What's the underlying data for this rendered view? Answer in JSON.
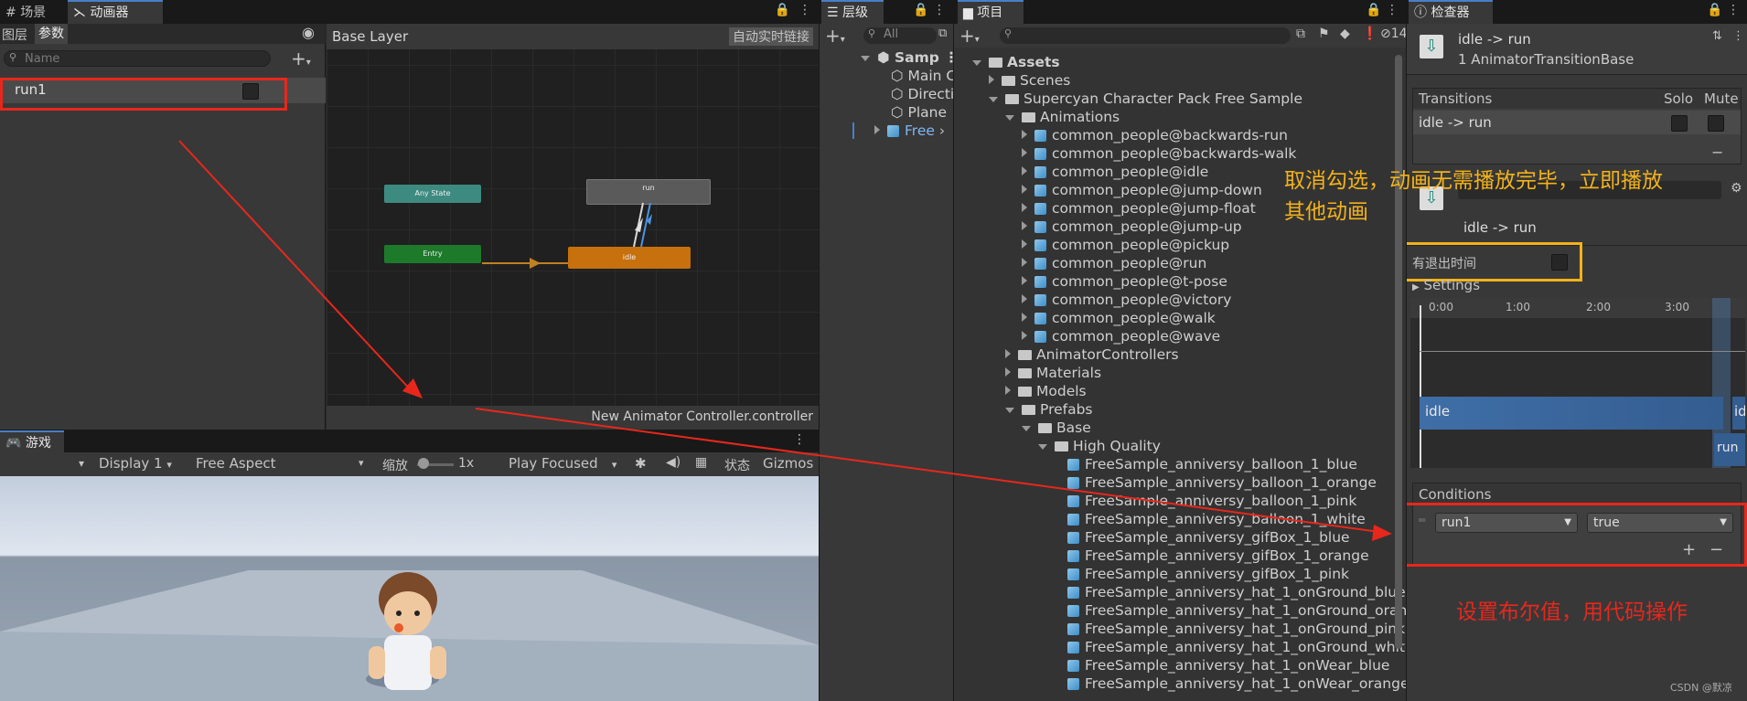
{
  "animator": {
    "tab_scene": "场景",
    "tab_animator": "动画器",
    "subtab_layers": "图层",
    "subtab_params": "参数",
    "search_placeholder": "Name",
    "param_name": "run1",
    "layer_name": "Base Layer",
    "auto_live_link": "自动实时链接",
    "nodes": {
      "any_state": "Any State",
      "entry": "Entry",
      "run": "run",
      "idle": "idle"
    },
    "controller_file": "New Animator Controller.controller"
  },
  "game": {
    "tab": "游戏",
    "display": "Display 1",
    "aspect": "Free Aspect",
    "scale_label": "缩放",
    "scale_value": "1x",
    "play_mode": "Play Focused",
    "stats": "状态",
    "gizmos": "Gizmos"
  },
  "hierarchy": {
    "tab": "层级",
    "search": "All",
    "items": [
      "Samp",
      "Main C",
      "Directi",
      "Plane",
      "Free"
    ]
  },
  "project": {
    "tab": "项目",
    "count": "14",
    "tree": [
      {
        "label": "Assets",
        "level": 0,
        "kind": "folder",
        "expanded": true
      },
      {
        "label": "Scenes",
        "level": 1,
        "kind": "folder",
        "expanded": false
      },
      {
        "label": "Supercyan Character Pack Free Sample",
        "level": 1,
        "kind": "folder",
        "expanded": true
      },
      {
        "label": "Animations",
        "level": 2,
        "kind": "folder",
        "expanded": true
      },
      {
        "label": "common_people@backwards-run",
        "level": 3,
        "kind": "asset",
        "expanded": false
      },
      {
        "label": "common_people@backwards-walk",
        "level": 3,
        "kind": "asset",
        "expanded": false
      },
      {
        "label": "common_people@idle",
        "level": 3,
        "kind": "asset",
        "expanded": false
      },
      {
        "label": "common_people@jump-down",
        "level": 3,
        "kind": "asset",
        "expanded": false
      },
      {
        "label": "common_people@jump-float",
        "level": 3,
        "kind": "asset",
        "expanded": false
      },
      {
        "label": "common_people@jump-up",
        "level": 3,
        "kind": "asset",
        "expanded": false
      },
      {
        "label": "common_people@pickup",
        "level": 3,
        "kind": "asset",
        "expanded": false
      },
      {
        "label": "common_people@run",
        "level": 3,
        "kind": "asset",
        "expanded": false
      },
      {
        "label": "common_people@t-pose",
        "level": 3,
        "kind": "asset",
        "expanded": false
      },
      {
        "label": "common_people@victory",
        "level": 3,
        "kind": "asset",
        "expanded": false
      },
      {
        "label": "common_people@walk",
        "level": 3,
        "kind": "asset",
        "expanded": false
      },
      {
        "label": "common_people@wave",
        "level": 3,
        "kind": "asset",
        "expanded": false
      },
      {
        "label": "AnimatorControllers",
        "level": 2,
        "kind": "folder",
        "expanded": false
      },
      {
        "label": "Materials",
        "level": 2,
        "kind": "folder",
        "expanded": false
      },
      {
        "label": "Models",
        "level": 2,
        "kind": "folder",
        "expanded": false
      },
      {
        "label": "Prefabs",
        "level": 2,
        "kind": "folder",
        "expanded": true
      },
      {
        "label": "Base",
        "level": 3,
        "kind": "folder",
        "expanded": true
      },
      {
        "label": "High Quality",
        "level": 4,
        "kind": "folder",
        "expanded": true
      },
      {
        "label": "FreeSample_anniversy_balloon_1_blue",
        "level": 5,
        "kind": "prefab"
      },
      {
        "label": "FreeSample_anniversy_balloon_1_orange",
        "level": 5,
        "kind": "prefab"
      },
      {
        "label": "FreeSample_anniversy_balloon_1_pink",
        "level": 5,
        "kind": "prefab"
      },
      {
        "label": "FreeSample_anniversy_balloon_1_white",
        "level": 5,
        "kind": "prefab"
      },
      {
        "label": "FreeSample_anniversy_gifBox_1_blue",
        "level": 5,
        "kind": "prefab"
      },
      {
        "label": "FreeSample_anniversy_gifBox_1_orange",
        "level": 5,
        "kind": "prefab"
      },
      {
        "label": "FreeSample_anniversy_gifBox_1_pink",
        "level": 5,
        "kind": "prefab"
      },
      {
        "label": "FreeSample_anniversy_hat_1_onGround_blue",
        "level": 5,
        "kind": "prefab"
      },
      {
        "label": "FreeSample_anniversy_hat_1_onGround_orange",
        "level": 5,
        "kind": "prefab"
      },
      {
        "label": "FreeSample_anniversy_hat_1_onGround_pink",
        "level": 5,
        "kind": "prefab"
      },
      {
        "label": "FreeSample_anniversy_hat_1_onGround_white",
        "level": 5,
        "kind": "prefab"
      },
      {
        "label": "FreeSample_anniversy_hat_1_onWear_blue",
        "level": 5,
        "kind": "prefab"
      },
      {
        "label": "FreeSample_anniversy_hat_1_onWear_orange",
        "level": 5,
        "kind": "prefab"
      }
    ]
  },
  "inspector": {
    "tab": "检查器",
    "title": "idle -> run",
    "subtitle": "1 AnimatorTransitionBase",
    "transitions_header": "Transitions",
    "solo": "Solo",
    "mute": "Mute",
    "transition_item": "idle -> run",
    "transition_label": "idle -> run",
    "has_exit_time": "有退出时间",
    "settings": "Settings",
    "timeline_ticks": [
      "0:00",
      "1:00",
      "2:00",
      "3:00"
    ],
    "clip_idle": "idle",
    "clip_idle_tail": "id",
    "clip_run": "run",
    "conditions_header": "Conditions",
    "condition_param": "run1",
    "condition_value": "true"
  },
  "annotations": {
    "exit_time_note_line1": "取消勾选，动画无需播放完毕，立即播放",
    "exit_time_note_line2": "其他动画",
    "bool_note": "设置布尔值，用代码操作",
    "watermark": "CSDN @默凉"
  },
  "colors": {
    "accent": "#4a7ec7",
    "annotation_red": "#e8271c",
    "annotation_yellow": "#f2b21a",
    "idle_node": "#c7700e",
    "entry_node": "#1d7a2b",
    "any_state_node": "#3d8a80"
  }
}
